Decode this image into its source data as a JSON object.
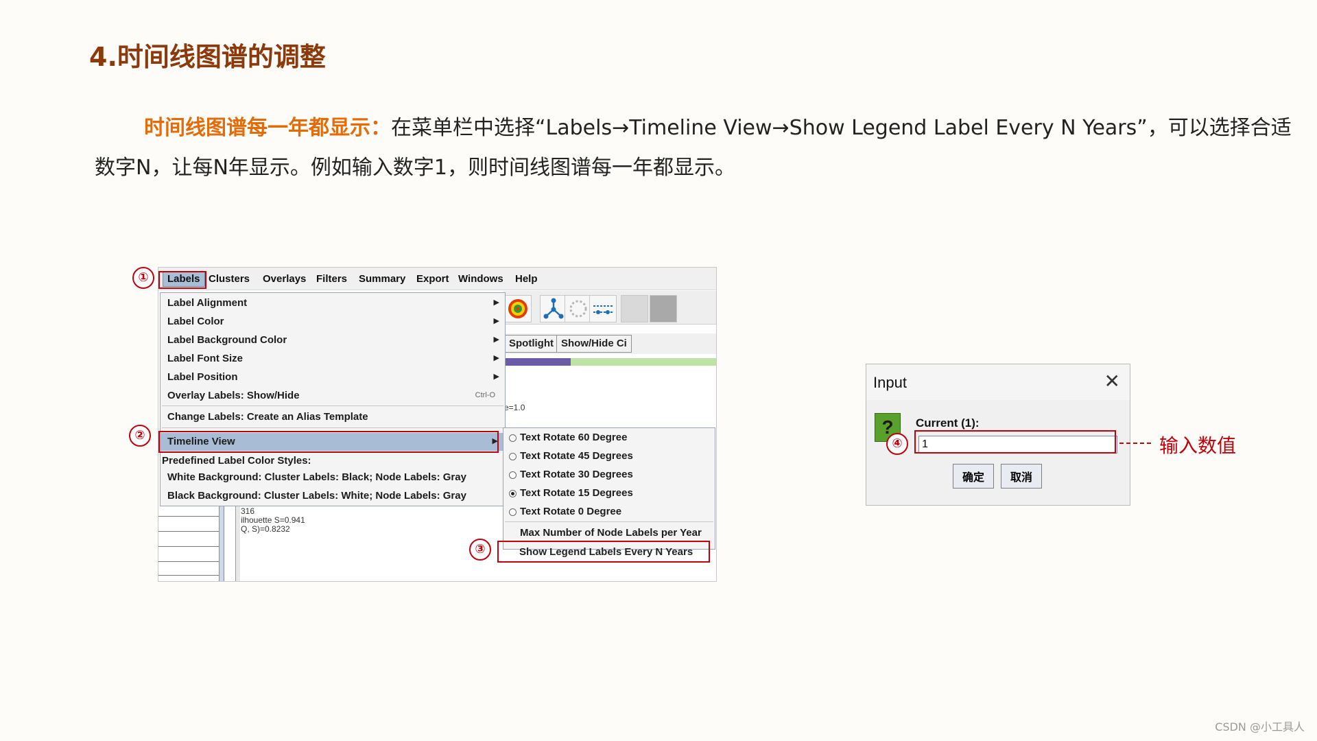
{
  "slide": {
    "title": "4.时间线图谱的调整",
    "para_highlight": "时间线图谱每一年都显示：",
    "para_line1_rest": "在菜单栏中选择“Labels→Timeline View→Show Legend Label Every N Years”，可以选择合适",
    "para_line2": "数字N，让每N年显示。例如输入数字1，则时间线图谱每一年都显示。"
  },
  "menubar": {
    "items": [
      "Labels",
      "Clusters",
      "Overlays",
      "Filters",
      "Summary",
      "Export",
      "Windows",
      "Help"
    ]
  },
  "toolbar": {
    "spotlight": "Spotlight",
    "show_hide": "Show/Hide Ci"
  },
  "background_text": {
    "e_value": "e=1.0",
    "line1": "316",
    "line2": "ilhouette S=0.941",
    "line3": "Q, S)=0.8232"
  },
  "labels_menu": {
    "items": [
      "Label Alignment",
      "Label Color",
      "Label Background Color",
      "Label Font Size",
      "Label Position",
      "Overlay Labels: Show/Hide"
    ],
    "overlay_shortcut": "Ctrl-O",
    "change_labels": "Change Labels: Create an Alias Template",
    "timeline_view": "Timeline View",
    "predefined_header": "Predefined Label Color Styles:",
    "style_white": "White Background: Cluster Labels: Black; Node Labels: Gray",
    "style_black": "Black Background: Cluster Labels: White; Node Labels: Gray"
  },
  "timeline_submenu": {
    "rotate_items": [
      "Text Rotate 60 Degree",
      "Text Rotate 45 Degrees",
      "Text Rotate 30 Degrees",
      "Text Rotate 15 Degrees",
      "Text Rotate 0 Degree"
    ],
    "selected_index": 3,
    "max_labels": "Max Number of Node Labels per Year",
    "show_legend": "Show Legend Labels Every N Years"
  },
  "badges": [
    "①",
    "②",
    "③",
    "④"
  ],
  "dialog": {
    "title": "Input",
    "label": "Current (1):",
    "value": "1",
    "ok": "确定",
    "cancel": "取消"
  },
  "input_note": "输入数值",
  "watermark": "CSDN @小工具人",
  "colors": {
    "title": "#8b3a0c",
    "highlight": "#e36c09",
    "annotation_red": "#c0000b",
    "menu_selection": "#a8bdd5"
  }
}
